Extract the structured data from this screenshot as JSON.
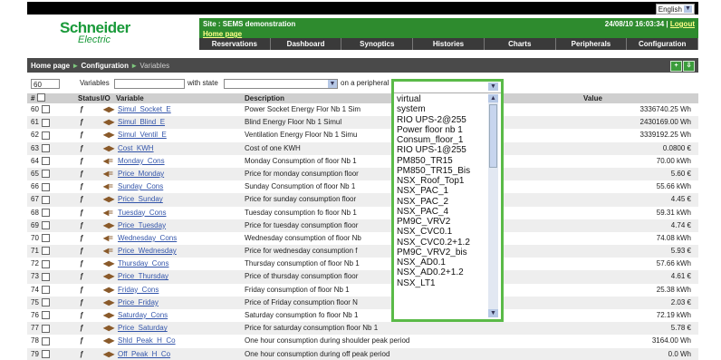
{
  "header": {
    "language": "English",
    "logo_line1": "Schneider",
    "logo_line2": "Electric",
    "site": "Site : SEMS demonstration",
    "home_link": "Home page",
    "datetime": "24/08/10 16:03:34 |",
    "logout": "Logout"
  },
  "nav": [
    "Reservations",
    "Dashboard",
    "Synoptics",
    "Histories",
    "Charts",
    "Peripherals",
    "Configuration"
  ],
  "breadcrumb": {
    "home": "Home page",
    "sep": "►",
    "config": "Configuration",
    "current": "Variables"
  },
  "filter": {
    "count": "60",
    "variables_label": "Variables",
    "state_label": "with state",
    "peripheral_label": "on a peripheral"
  },
  "table": {
    "headers": {
      "num": "#",
      "status": "Status",
      "io": "I/O",
      "variable": "Variable",
      "description": "Description",
      "value": "Value"
    },
    "rows": [
      {
        "num": "60",
        "icon": "◀▶",
        "name": "Simul_Socket_E",
        "desc": "Power Socket Energy Flor Nb 1 Sim",
        "value": "3336740.25 Wh"
      },
      {
        "num": "61",
        "icon": "◀▶",
        "name": "Simul_Blind_E",
        "desc": "Blind Energy Floor Nb 1 Simul",
        "value": "2430169.00 Wh"
      },
      {
        "num": "62",
        "icon": "◀▶",
        "name": "Simul_Ventil_E",
        "desc": "Ventilation Energy Floor Nb 1 Simu",
        "value": "3339192.25 Wh"
      },
      {
        "num": "63",
        "icon": "◀▶",
        "name": "Cost_KWH",
        "desc": "Cost of one KWH",
        "value": "0.0800 €"
      },
      {
        "num": "64",
        "icon": "◀=",
        "name": "Monday_Cons",
        "desc": "Monday Consumption of floor Nb 1",
        "value": "70.00 kWh"
      },
      {
        "num": "65",
        "icon": "◀=",
        "name": "Price_Monday",
        "desc": "Price for monday consumption floor",
        "value": "5.60 €"
      },
      {
        "num": "66",
        "icon": "◀=",
        "name": "Sunday_Cons",
        "desc": "Sunday Consumption of floor Nb 1",
        "value": "55.66 kWh"
      },
      {
        "num": "67",
        "icon": "◀▶",
        "name": "Price_Sunday",
        "desc": "Price for sunday consumption floor",
        "value": "4.45 €"
      },
      {
        "num": "68",
        "icon": "◀=",
        "name": "Tuesday_Cons",
        "desc": "Tuesday consumption fo floor Nb 1",
        "value": "59.31 kWh"
      },
      {
        "num": "69",
        "icon": "◀▶",
        "name": "Price_Tuesday",
        "desc": "Price for tuesday consumption floor",
        "value": "4.74 €"
      },
      {
        "num": "70",
        "icon": "◀=",
        "name": "Wednesday_Cons",
        "desc": "Wednesday consumption of floor Nb",
        "value": "74.08 kWh"
      },
      {
        "num": "71",
        "icon": "◀=",
        "name": "Price_Wednesday",
        "desc": "Price for wednesday consumption f",
        "value": "5.93 €"
      },
      {
        "num": "72",
        "icon": "◀▶",
        "name": "Thursday_Cons",
        "desc": "Thursday consumption of floor Nb 1",
        "value": "57.66 kWh"
      },
      {
        "num": "73",
        "icon": "◀▶",
        "name": "Price_Thursday",
        "desc": "Price of thursday consumption floor",
        "value": "4.61 €"
      },
      {
        "num": "74",
        "icon": "◀▶",
        "name": "Friday_Cons",
        "desc": "Friday consumption of floor Nb 1",
        "value": "25.38 kWh"
      },
      {
        "num": "75",
        "icon": "◀▶",
        "name": "Price_Friday",
        "desc": "Price of Friday consumption floor N",
        "value": "2.03 €"
      },
      {
        "num": "76",
        "icon": "◀▶",
        "name": "Saturday_Cons",
        "desc": "Saturday consumption fo floor Nb 1",
        "value": "72.19 kWh"
      },
      {
        "num": "77",
        "icon": "◀▶",
        "name": "Price_Saturday",
        "desc": "Price for saturday consumption floor Nb 1",
        "value": "5.78 €"
      },
      {
        "num": "78",
        "icon": "◀▶",
        "name": "Shld_Peak_H_Co",
        "desc": "One hour consumption during shoulder peak period",
        "value": "3164.00 Wh"
      },
      {
        "num": "79",
        "icon": "◀▶",
        "name": "Off_Peak_H_Co",
        "desc": "One hour consumption during off peak period",
        "value": "0.0 Wh"
      }
    ]
  },
  "dropdown": {
    "options": [
      "virtual",
      "system",
      "RIO UPS-2@255",
      "Power floor nb 1",
      "Consum_floor_1",
      "RIO UPS-1@255",
      "PM850_TR15",
      "PM850_TR15_Bis",
      "NSX_Roof_Top1",
      "NSX_PAC_1",
      "NSX_PAC_2",
      "NSX_PAC_4",
      "PM9C_VRV2",
      "NSX_CVC0.1",
      "NSX_CVC0.2+1.2",
      "PM9C_VRV2_bis",
      "NSX_AD0.1",
      "NSX_AD0.2+1.2",
      "NSX_LT1"
    ],
    "highlight_color": "#5aba48"
  },
  "colors": {
    "green": "#2e8b2e",
    "nav": "#3a3a3a",
    "link": "#3355aa"
  }
}
